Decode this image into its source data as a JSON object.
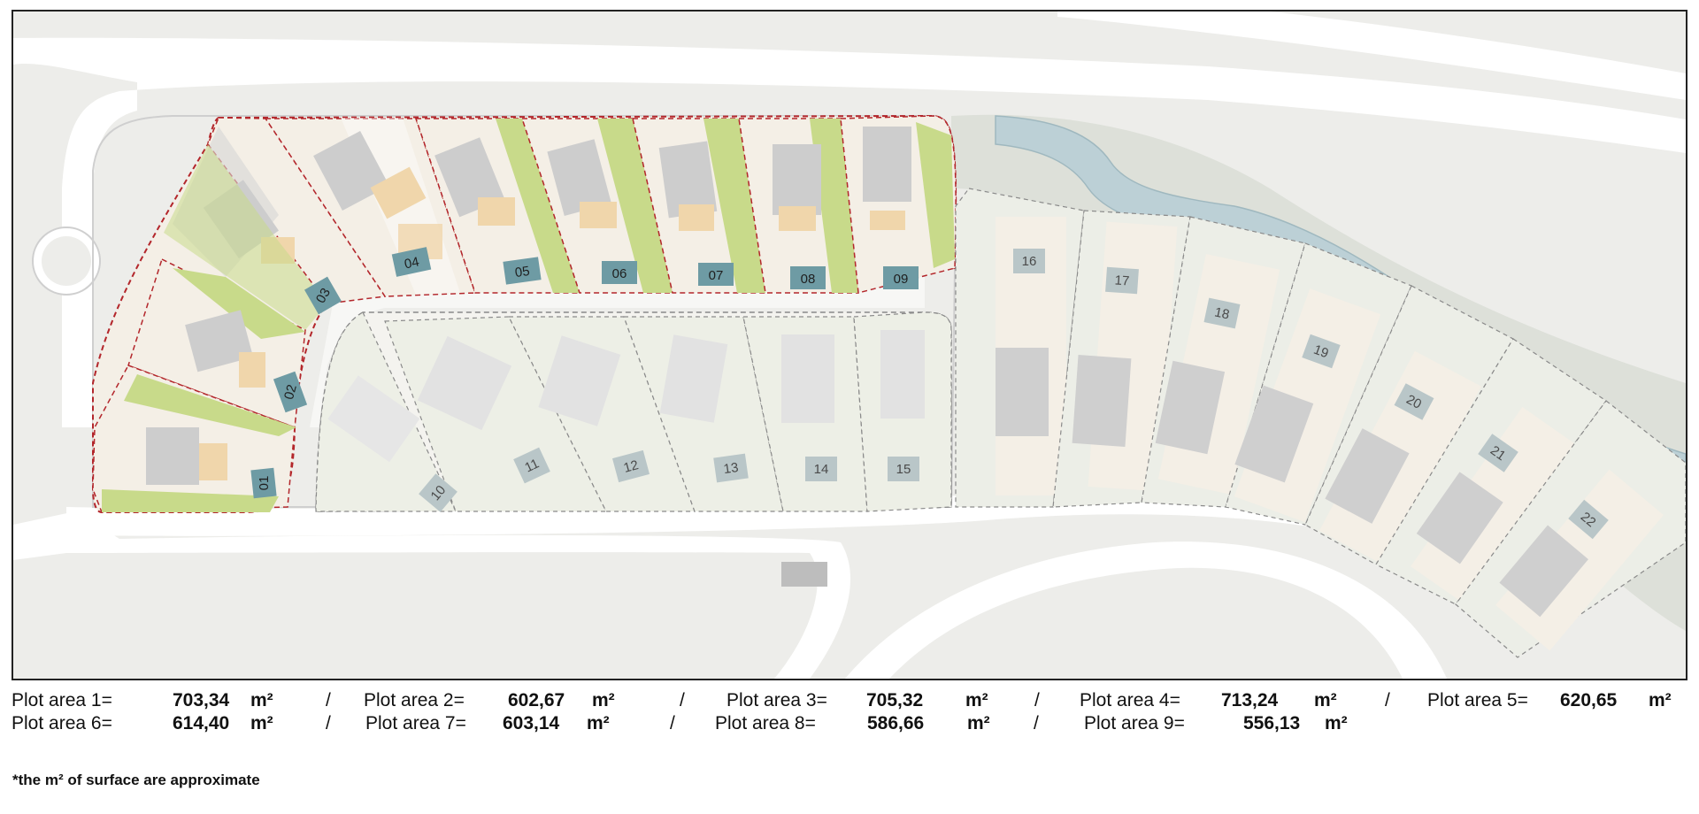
{
  "map": {
    "plots_red": [
      "01",
      "02",
      "03",
      "04",
      "05",
      "06",
      "07",
      "08",
      "09"
    ],
    "plots_grey": [
      "10",
      "11",
      "12",
      "13",
      "14",
      "15",
      "16",
      "17",
      "18",
      "19",
      "20",
      "21",
      "22"
    ],
    "colors": {
      "background": "#ededea",
      "road": "#ffffff",
      "river": "#bcd0d6",
      "riverbank": "#d9ddd6",
      "green": "#c8da8a",
      "deck": "#f0d6ab",
      "plot_fill": "#f4efe6",
      "plot_border_red": "#b3262b",
      "plot_border_grey": "#7a7a7a",
      "house": "#c9c9c9",
      "pool": "#6e9ba4",
      "pool_pale": "#b9c6c8"
    }
  },
  "legend": {
    "rows": [
      [
        {
          "label": "Plot area 1=",
          "value": "703,34",
          "unit": "m²"
        },
        {
          "label": "Plot area 2=",
          "value": "602,67",
          "unit": "m²"
        },
        {
          "label": "Plot area 3=",
          "value": "705,32",
          "unit": "m²"
        },
        {
          "label": "Plot area 4=",
          "value": "713,24",
          "unit": "m²"
        },
        {
          "label": "Plot area 5=",
          "value": "620,65",
          "unit": "m²"
        }
      ],
      [
        {
          "label": "Plot area 6=",
          "value": "614,40",
          "unit": "m²"
        },
        {
          "label": "Plot area 7=",
          "value": "603,14",
          "unit": "m²"
        },
        {
          "label": "Plot area 8=",
          "value": "586,66",
          "unit": "m²"
        },
        {
          "label": "Plot area 9=",
          "value": "556,13",
          "unit": "m²"
        }
      ]
    ],
    "separator": "/"
  },
  "footnote": "*the m² of surface are approximate"
}
